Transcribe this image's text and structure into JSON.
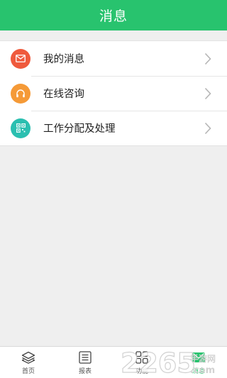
{
  "header": {
    "title": "消息"
  },
  "menu": {
    "items": [
      {
        "label": "我的消息",
        "icon": "mail-icon",
        "color": "#ef5a3d"
      },
      {
        "label": "在线咨询",
        "icon": "headphones-icon",
        "color": "#f59a37"
      },
      {
        "label": "工作分配及处理",
        "icon": "qr-code-icon",
        "color": "#2bbfb0"
      }
    ]
  },
  "tabbar": {
    "tabs": [
      {
        "label": "首页",
        "icon": "layers-icon"
      },
      {
        "label": "报表",
        "icon": "report-icon"
      },
      {
        "label": "功能",
        "icon": "grid-icon"
      },
      {
        "label": "消息",
        "icon": "message-icon"
      }
    ],
    "active_index": 3
  },
  "watermark": {
    "number": "2265",
    "text": ".com",
    "chinese": "手游网"
  },
  "colors": {
    "accent": "#28c36e",
    "background": "#efefef"
  }
}
